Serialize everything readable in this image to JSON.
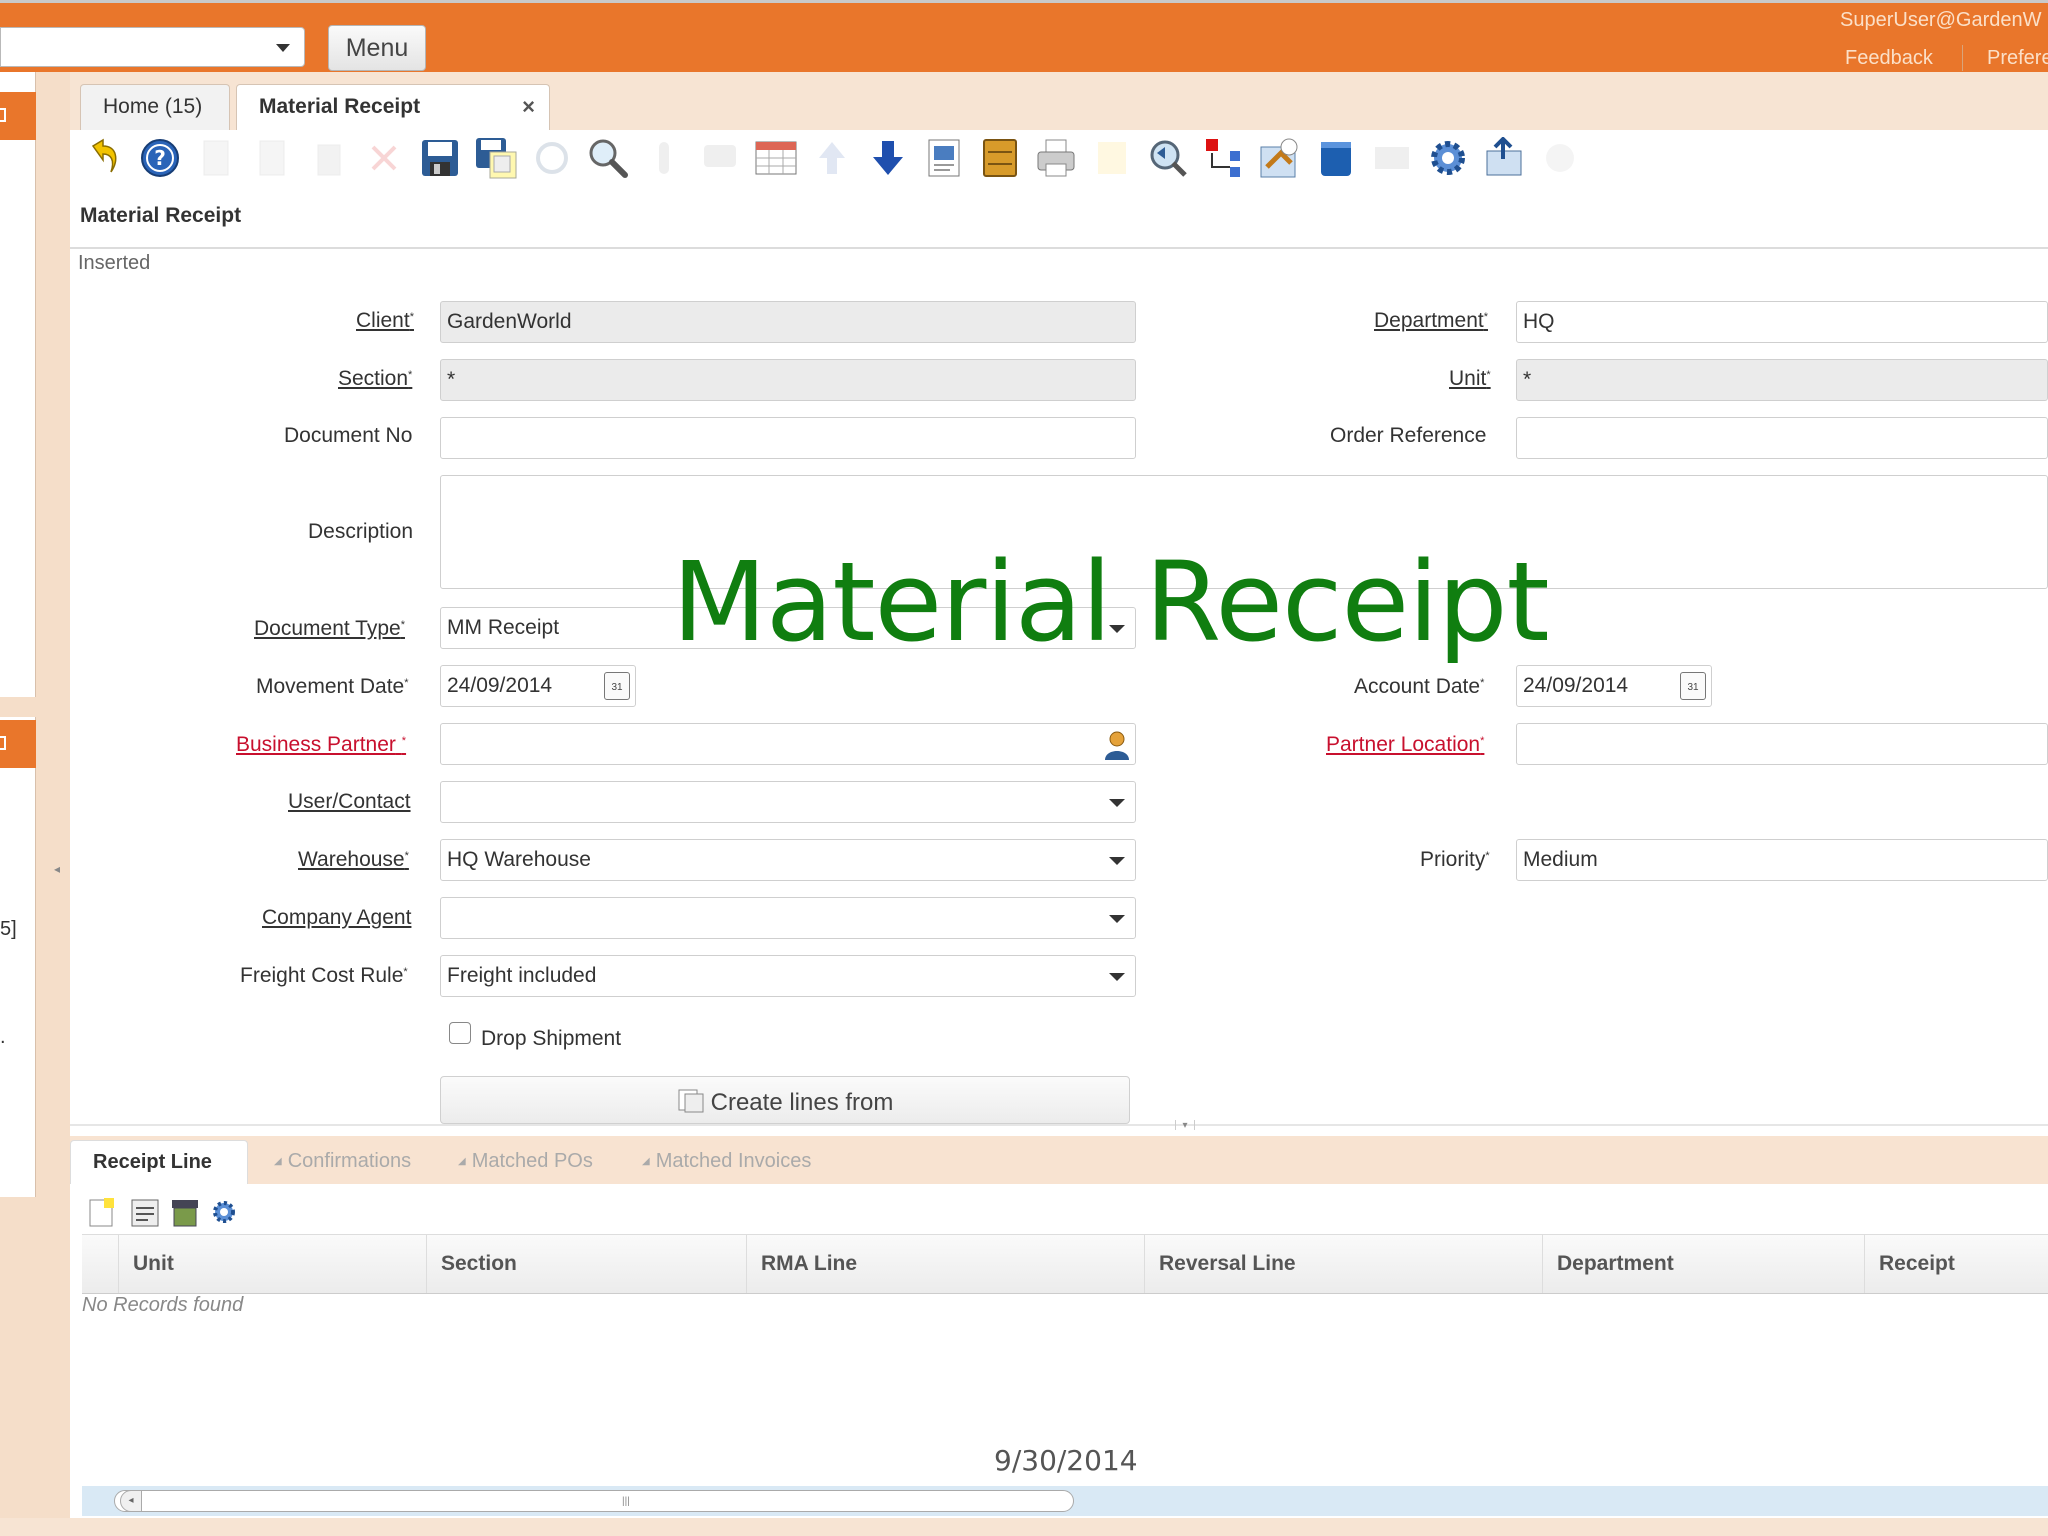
{
  "topbar": {
    "menu_label": "Menu",
    "user": "SuperUser@GardenW",
    "feedback": "Feedback",
    "preferences": "Prefere"
  },
  "left_panel": {
    "fragment_1": "5]",
    "fragment_2": "."
  },
  "tabs": [
    {
      "label": "Home (15)"
    },
    {
      "label": "Material Receipt",
      "close": "×"
    }
  ],
  "toolbar_icons": [
    "undo-icon",
    "help-icon",
    "new-record-icon",
    "copy-record-icon",
    "delete-icon",
    "delete-selection-icon",
    "save-icon",
    "save-and-new-icon",
    "refresh-icon",
    "find-icon",
    "attachment-icon",
    "chat-icon",
    "grid-toggle-icon",
    "previous-record-icon",
    "next-record-icon",
    "report-icon",
    "archive-icon",
    "print-icon",
    "print-preview-icon",
    "zoom-across-icon",
    "workflow-icon",
    "request-icon",
    "product-info-icon",
    "process-icon",
    "settings-icon",
    "export-icon",
    "customize-icon"
  ],
  "window": {
    "title": "Material Receipt",
    "status": "Inserted"
  },
  "form": {
    "client_label": "Client",
    "client_value": "GardenWorld",
    "department_label": "Department",
    "department_value": "HQ",
    "section_label": "Section",
    "section_value": "*",
    "unit_label": "Unit",
    "unit_value": "*",
    "document_no_label": "Document No",
    "document_no_value": "",
    "order_reference_label": "Order Reference",
    "order_reference_value": "",
    "description_label": "Description",
    "description_value": "",
    "document_type_label": "Document Type",
    "document_type_value": "MM Receipt",
    "movement_date_label": "Movement Date",
    "movement_date_value": "24/09/2014",
    "account_date_label": "Account Date",
    "account_date_value": "24/09/2014",
    "business_partner_label": "Business Partner",
    "business_partner_value": "",
    "partner_location_label": "Partner Location",
    "partner_location_value": "",
    "user_contact_label": "User/Contact",
    "user_contact_value": "",
    "warehouse_label": "Warehouse",
    "warehouse_value": "HQ Warehouse",
    "priority_label": "Priority",
    "priority_value": "Medium",
    "company_agent_label": "Company Agent",
    "company_agent_value": "",
    "freight_cost_rule_label": "Freight Cost Rule",
    "freight_cost_rule_value": "Freight included",
    "drop_shipment_label": "Drop Shipment",
    "drop_shipment_checked": false,
    "create_lines_label": "Create lines from",
    "required_mark": "*"
  },
  "overlay_title": "Material Receipt",
  "subtabs": [
    {
      "label": "Receipt Line"
    },
    {
      "label": "Confirmations"
    },
    {
      "label": "Matched POs"
    },
    {
      "label": "Matched Invoices"
    }
  ],
  "grid": {
    "columns": [
      "Unit",
      "Section",
      "RMA Line",
      "Reversal Line",
      "Department",
      "Receipt"
    ],
    "empty_message": "No Records found"
  },
  "footer_date": "9/30/2014",
  "colors": {
    "accent": "#e9762b",
    "overlay_title": "#107e10",
    "required_link": "#c8102e"
  }
}
